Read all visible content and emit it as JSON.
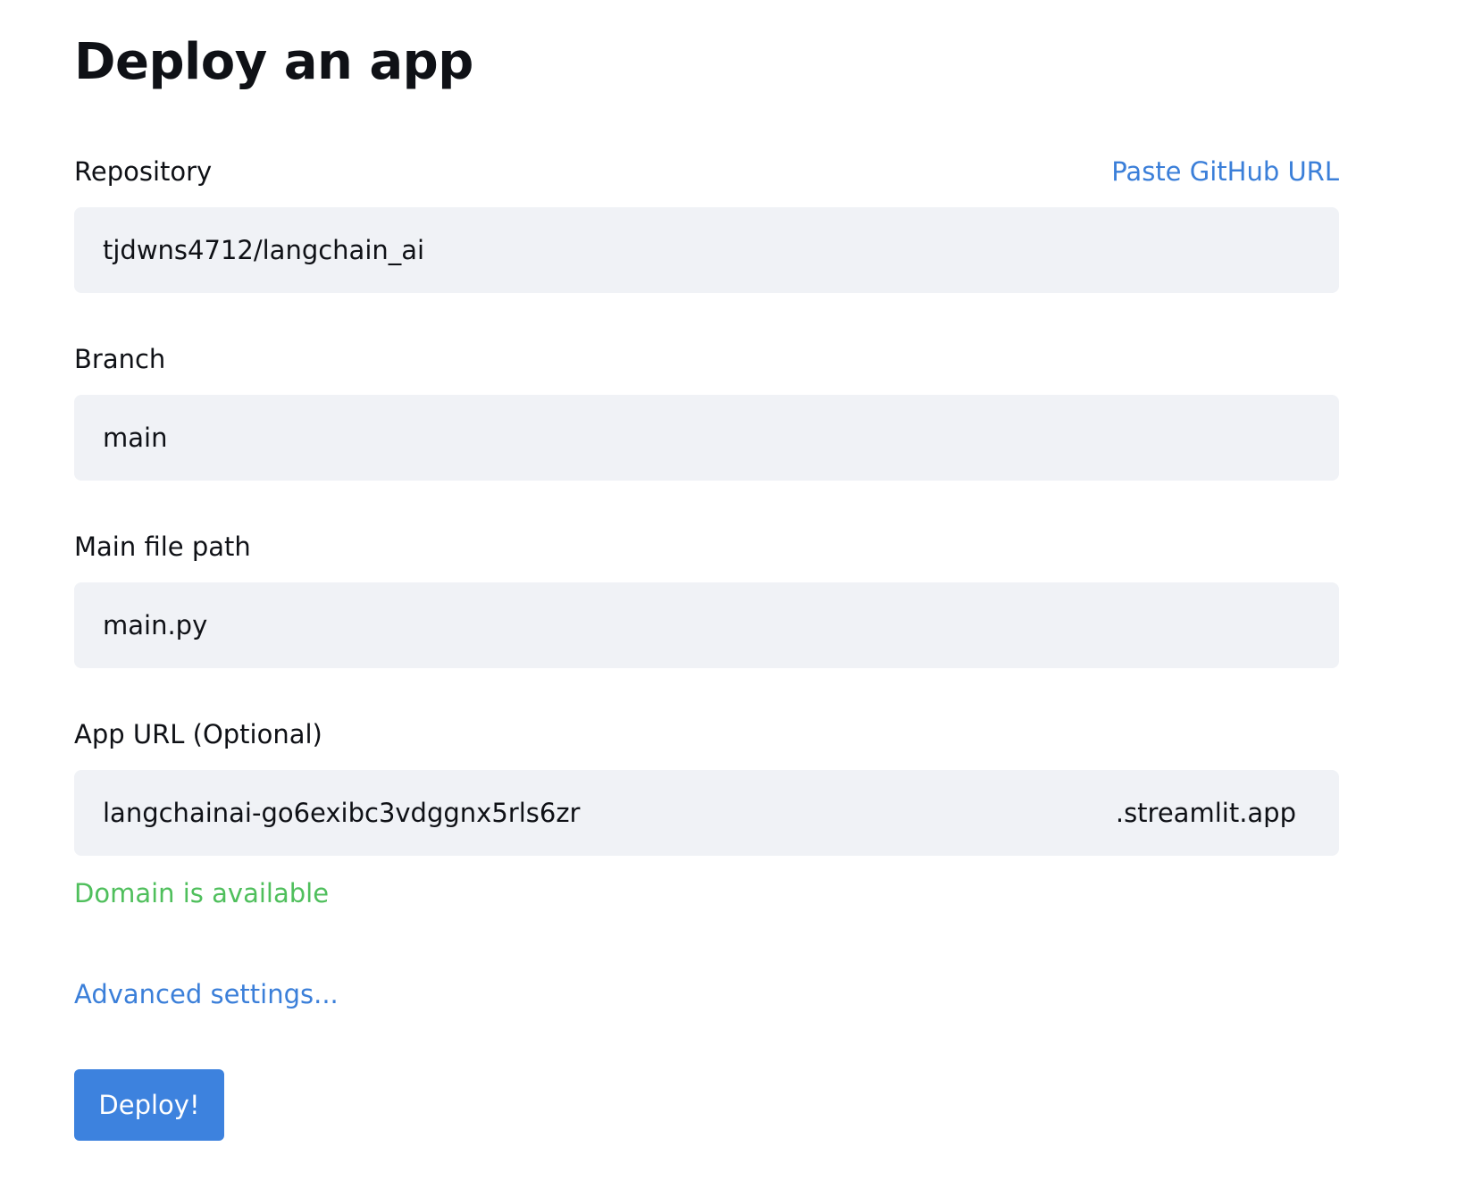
{
  "page": {
    "title": "Deploy an app"
  },
  "repository": {
    "label": "Repository",
    "paste_link": "Paste GitHub URL",
    "value": "tjdwns4712/langchain_ai"
  },
  "branch": {
    "label": "Branch",
    "value": "main"
  },
  "main_file": {
    "label": "Main file path",
    "value": "main.py"
  },
  "app_url": {
    "label": "App URL (Optional)",
    "value": "langchainai-go6exibc3vdggnx5rls6zr",
    "suffix": ".streamlit.app",
    "status": "Domain is available"
  },
  "advanced": {
    "label": "Advanced settings..."
  },
  "deploy": {
    "label": "Deploy!"
  },
  "colors": {
    "link": "#3b7fd9",
    "success": "#4fbf5c",
    "field_bg": "#f0f2f6",
    "button_bg": "#3d82de"
  }
}
